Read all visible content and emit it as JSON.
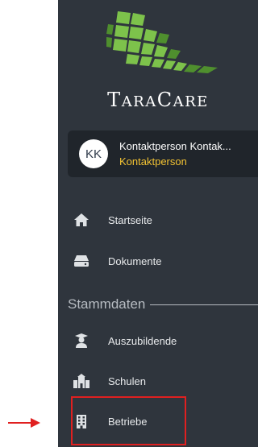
{
  "brand": {
    "name_initial": "T",
    "name_rest_1": "ARA",
    "name_c": "C",
    "name_rest_2": "ARE",
    "full": "TaraCare"
  },
  "user": {
    "initials": "KK",
    "name": "Kontaktperson Kontak...",
    "role": "Kontaktperson"
  },
  "nav": {
    "items": [
      {
        "label": "Startseite",
        "icon": "home-icon"
      },
      {
        "label": "Dokumente",
        "icon": "drive-icon"
      }
    ],
    "section": "Stammdaten",
    "section_items": [
      {
        "label": "Auszubildende",
        "icon": "student-icon"
      },
      {
        "label": "Schulen",
        "icon": "school-icon"
      },
      {
        "label": "Betriebe",
        "icon": "building-icon"
      }
    ]
  },
  "colors": {
    "sidebar": "#2f353d",
    "card": "#20252b",
    "accent": "#f2c232",
    "logo_green": "#7dc24b",
    "highlight": "#e02020"
  }
}
